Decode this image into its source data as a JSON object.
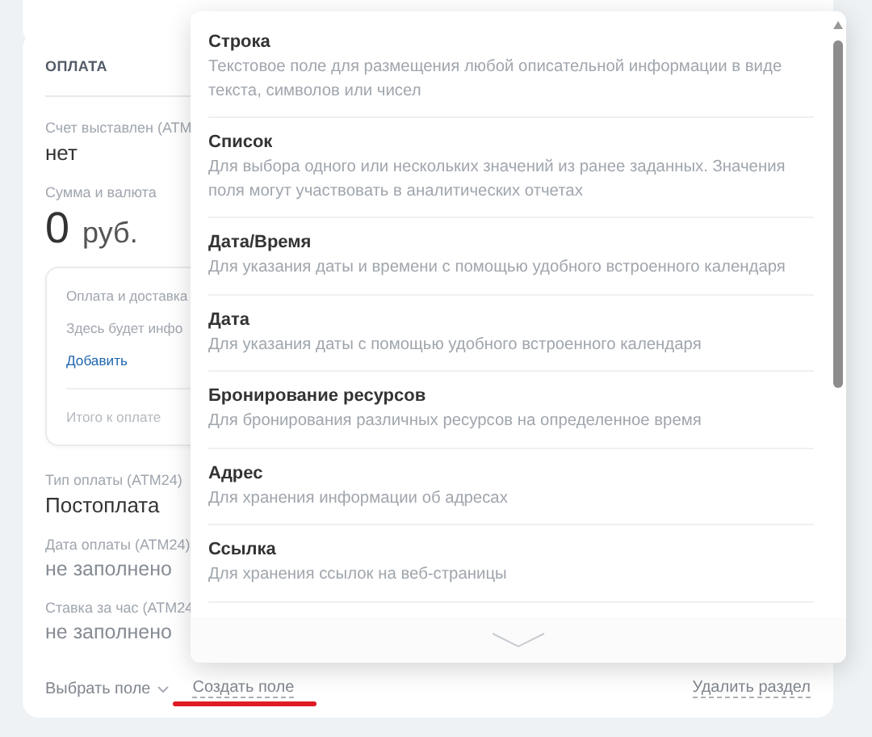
{
  "section": {
    "title": "ОПЛАТА",
    "top_fields": [
      {
        "label": "Счет выставлен (АТМ",
        "value": "нет",
        "kind": "filled"
      }
    ],
    "amount": {
      "label": "Сумма и валюта",
      "value": "0",
      "currency": "руб."
    },
    "inner_box": {
      "title": "Оплата и доставка",
      "hint": "Здесь будет инфо",
      "add_link": "Добавить",
      "total_label": "Итого к оплате"
    },
    "fields": [
      {
        "label": "Тип оплаты (АТМ24)",
        "value": "Постоплата",
        "kind": "filled"
      },
      {
        "label": "Дата оплаты (АТМ24)",
        "value": "не заполнено",
        "kind": "empty"
      },
      {
        "label": "Ставка за час (АТМ24",
        "value": "не заполнено",
        "kind": "empty"
      }
    ],
    "footer": {
      "select_field": "Выбрать поле",
      "create_field": "Создать поле",
      "delete_section": "Удалить раздел"
    }
  },
  "popup": {
    "items": [
      {
        "title": "Строка",
        "description": "Текстовое поле для размещения любой описательной информации в виде текста, символов или чисел"
      },
      {
        "title": "Список",
        "description": "Для выбора одного или нескольких значений из ранее заданных. Значения поля могут участвовать в аналитических отчетах"
      },
      {
        "title": "Дата/Время",
        "description": "Для указания даты и времени с помощью удобного встроенного календаря"
      },
      {
        "title": "Дата",
        "description": "Для указания даты с помощью удобного встроенного календаря"
      },
      {
        "title": "Бронирование ресурсов",
        "description": "Для бронирования различных ресурсов на определенное время"
      },
      {
        "title": "Адрес",
        "description": "Для хранения информации об адресах"
      },
      {
        "title": "Ссылка",
        "description": "Для хранения ссылок на веб-страницы"
      }
    ]
  }
}
